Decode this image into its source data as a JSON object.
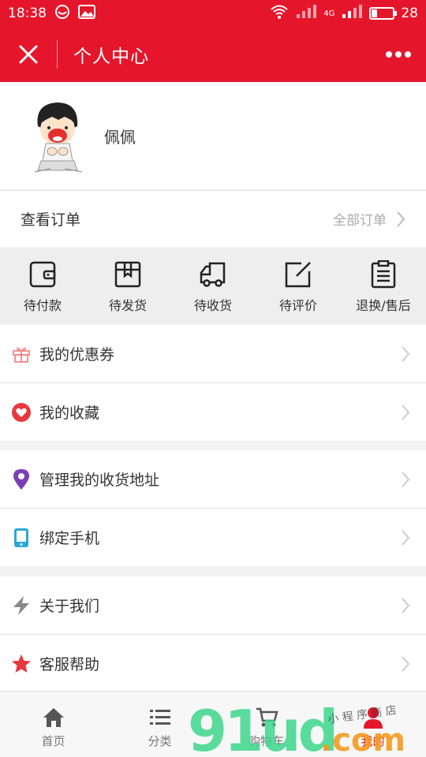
{
  "status_bar": {
    "time": "18:38",
    "battery": "28",
    "battery_level": 0.28,
    "network": "4G"
  },
  "header": {
    "title": "个人中心"
  },
  "profile": {
    "username": "佩佩"
  },
  "orders": {
    "label": "查看订单",
    "all_label": "全部订单"
  },
  "order_statuses": [
    {
      "label": "待付款",
      "icon": "wallet-icon"
    },
    {
      "label": "待发货",
      "icon": "box-icon"
    },
    {
      "label": "待收货",
      "icon": "truck-icon"
    },
    {
      "label": "待评价",
      "icon": "edit-icon"
    },
    {
      "label": "退换/售后",
      "icon": "clipboard-icon"
    }
  ],
  "menu": [
    {
      "label": "我的优惠券",
      "icon": "gift-icon"
    },
    {
      "label": "我的收藏",
      "icon": "heart-icon"
    },
    {
      "label": "管理我的收货地址",
      "icon": "location-icon"
    },
    {
      "label": "绑定手机",
      "icon": "phone-icon"
    },
    {
      "label": "关于我们",
      "icon": "lightning-icon"
    },
    {
      "label": "客服帮助",
      "icon": "star-icon"
    }
  ],
  "tabs": [
    {
      "label": "首页",
      "icon": "home-icon"
    },
    {
      "label": "分类",
      "icon": "list-icon"
    },
    {
      "label": "购物车",
      "icon": "cart-icon"
    },
    {
      "label": "我的",
      "icon": "user-icon",
      "active": true
    }
  ],
  "watermark": {
    "text": "91ud",
    "suffix": ".com",
    "tagline": "小 程 序 商 店"
  },
  "colors": {
    "brand": "#e5162b",
    "watermark_green": "#3dd68c",
    "watermark_orange": "#f29a1d"
  }
}
